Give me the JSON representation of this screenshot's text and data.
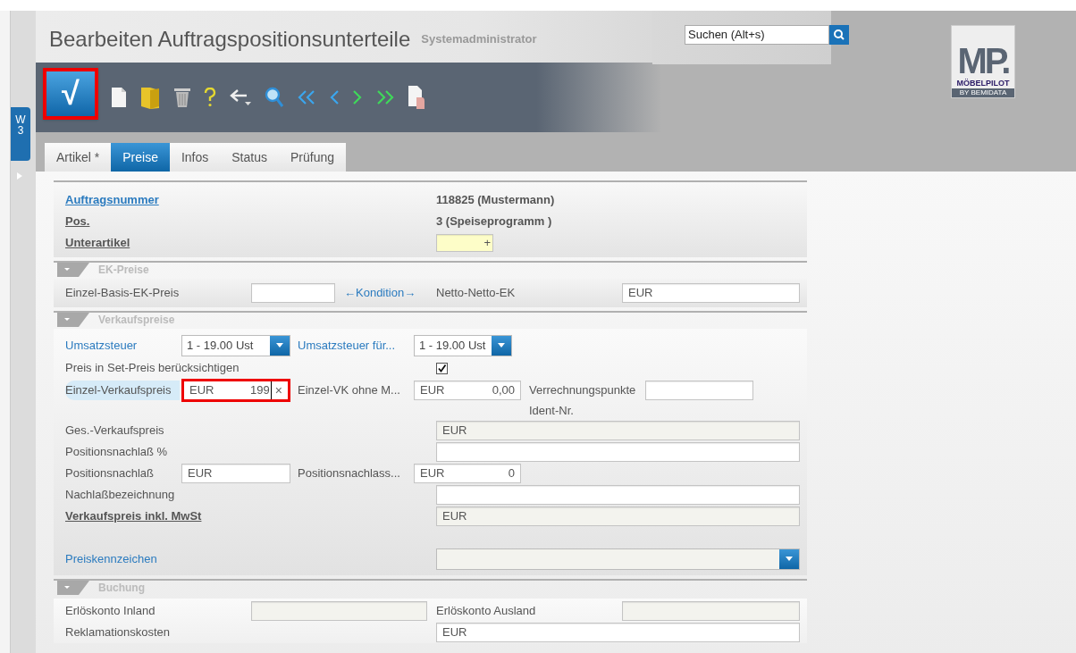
{
  "header": {
    "title": "Bearbeiten Auftragspositionsunterteile",
    "user": "Systemadministrator",
    "search": {
      "value": "Suchen (Alt+s)"
    },
    "logo": {
      "mark": "MP.",
      "name": "MÖBELPILOT",
      "tagline": "BY BEMIDATA"
    }
  },
  "side_tab": {
    "lines": [
      "W",
      "3"
    ]
  },
  "toolbar": {
    "save": {
      "glyph": "√",
      "highlighted": true
    }
  },
  "tabs": [
    {
      "label": "Artikel *",
      "selected": false
    },
    {
      "label": "Preise",
      "selected": true
    },
    {
      "label": "Infos",
      "selected": false
    },
    {
      "label": "Status",
      "selected": false
    },
    {
      "label": "Prüfung",
      "selected": false
    }
  ],
  "order_info": [
    {
      "label": "Auftragsnummer",
      "kind": "link",
      "value": "118825 (Mustermann)"
    },
    {
      "label": "Pos.",
      "kind": "bold",
      "value": "3 (Speiseprogramm )"
    },
    {
      "label": "Unterartikel",
      "kind": "bold",
      "field": {
        "value": "+"
      }
    }
  ],
  "ek_section": {
    "title": "EK-Preise",
    "basis_label": "Einzel-Basis-EK-Preis",
    "basis_field": {
      "readonly": false
    },
    "condition_link": "←Kondition→",
    "netto_label": "Netto-Netto-EK",
    "netto_field": {
      "currency": "EUR"
    }
  },
  "vk_section": {
    "title": "Verkaufspreise",
    "vat_label": "Umsatzsteuer",
    "vat_select": {
      "value": "1 - 19.00 Ust"
    },
    "vat2_label": "Umsatzsteuer für...",
    "vat2_select": {
      "value": "1 - 19.00 Ust"
    },
    "set_label": "Preis in Set-Preis berücksichtigen",
    "set_checked": true,
    "unit_label": "Einzel-Verkaufspreis",
    "unit_field": {
      "currency": "EUR",
      "value": "199",
      "clear": "×",
      "focused": true,
      "highlighted": true
    },
    "unit_net_label": "Einzel-VK ohne M...",
    "unit_net_field": {
      "currency": "EUR",
      "value": "0,00"
    },
    "points_label": "Verrechnungspunkte",
    "points_field": {
      "readonly": false
    },
    "ident_label": "Ident-Nr.",
    "total_label": "Ges.-Verkaufspreis",
    "total_field": {
      "currency": "EUR",
      "readonly": true
    },
    "discount_pct_label": "Positionsnachlaß %",
    "discount_pct_field": {
      "readonly": false
    },
    "discount_label": "Positionsnachlaß",
    "discount_field": {
      "currency": "EUR"
    },
    "discount2_label": "Positionsnachlass...",
    "discount2_field": {
      "currency": "EUR",
      "value": "0"
    },
    "discount_name_label": "Nachlaßbezeichnung",
    "discount_name_field": {
      "readonly": false
    },
    "gross_label": "Verkaufspreis inkl. MwSt",
    "gross_field": {
      "currency": "EUR",
      "readonly": true
    },
    "price_flag_label": "Preiskennzeichen",
    "price_flag_select": {
      "readonly": true
    }
  },
  "booking_section": {
    "title": "Buchung",
    "domestic_label": "Erlöskonto Inland",
    "domestic_field": {
      "readonly": true
    },
    "foreign_label": "Erlöskonto Ausland",
    "foreign_field": {
      "readonly": true
    },
    "complaint_label": "Reklamationskosten",
    "complaint_field": {
      "currency": "EUR"
    }
  }
}
